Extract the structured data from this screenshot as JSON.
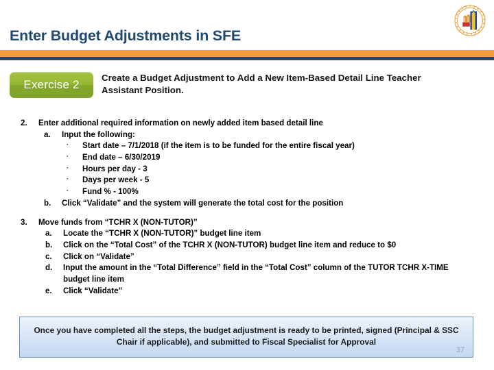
{
  "header": {
    "title": "Enter Budget Adjustments in SFE",
    "rule_orange_color": "#f59a3e",
    "rule_navy_color": "#2e4663",
    "title_color": "#21486e",
    "seal_icon": "university-seal-icon"
  },
  "exercise": {
    "badge_label": "Exercise 2",
    "badge_color": "#96b733",
    "description": "Create a Budget Adjustment to Add a New Item-Based Detail Line Teacher Assistant Position."
  },
  "body": {
    "items": [
      {
        "marker": "2.",
        "text": "Enter additional required information on newly added item based detail line"
      },
      {
        "marker": "a.",
        "text": "Input the following:"
      },
      {
        "marker": "·",
        "text": "Start date – 7/1/2018 (if the item is to be funded for the entire fiscal year)"
      },
      {
        "marker": "·",
        "text": "End date – 6/30/2019"
      },
      {
        "marker": "·",
        "text": "Hours per day - 3"
      },
      {
        "marker": "·",
        "text": "Days per week - 5"
      },
      {
        "marker": "·",
        "text": "Fund % - 100%"
      },
      {
        "marker": "b.",
        "text": "Click “Validate” and the system will generate the total cost for the position"
      },
      {
        "marker": "3.",
        "text": "Move funds from “TCHR X (NON-TUTOR)”"
      },
      {
        "marker": "a.",
        "text": "Locate the “TCHR X (NON-TUTOR)” budget line item"
      },
      {
        "marker": "b.",
        "text": "Click on the “Total Cost” of the TCHR X (NON-TUTOR) budget line item and reduce to $0"
      },
      {
        "marker": "c.",
        "text": "Click on “Validate”"
      },
      {
        "marker": "d.",
        "text": "Input the amount in the “Total Difference” field in the “Total Cost” column of the TUTOR TCHR X-TIME"
      },
      {
        "marker": "",
        "text": "budget line item"
      },
      {
        "marker": "e.",
        "text": "Click “Validate”"
      }
    ]
  },
  "callout": {
    "text": "Once you have completed all the steps, the budget adjustment is ready to be printed, signed (Principal & SSC Chair if applicable), and submitted  to Fiscal Specialist for Approval",
    "border_color": "#6b92bd",
    "background_top": "#eef4fc",
    "background_bottom": "#c3d8f1"
  },
  "footer": {
    "page_number": "37"
  }
}
